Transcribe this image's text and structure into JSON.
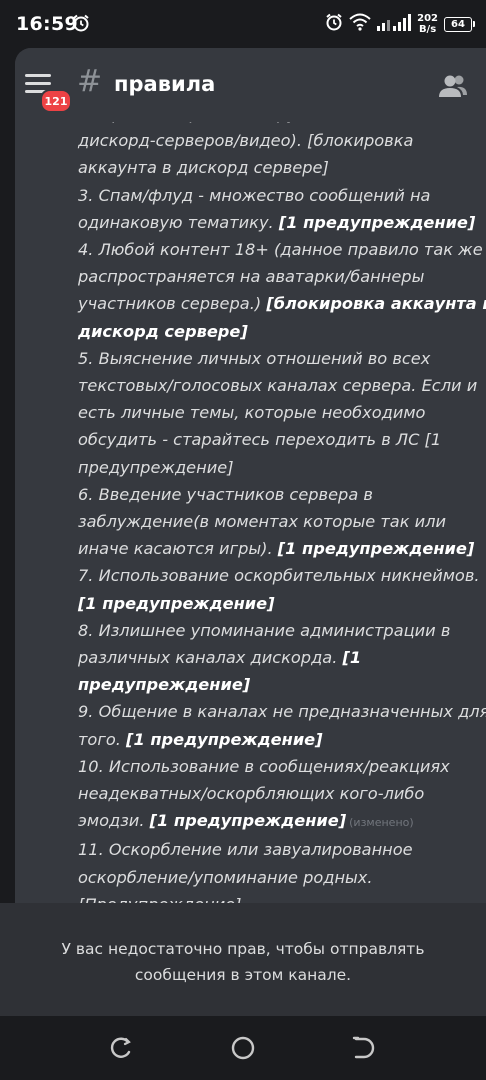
{
  "status_bar": {
    "time": "16:59",
    "net_speed_value": "202",
    "net_speed_unit": "B/s",
    "battery": "64"
  },
  "header": {
    "mention_count": "121",
    "hash_symbol": "#",
    "channel_name": "правила"
  },
  "message": {
    "lines": [
      {
        "t": "(сторонних проектов, групп, сайтов,",
        "b": ""
      },
      {
        "t": "дискорд-серверов/видео). [блокировка",
        "b": ""
      },
      {
        "t": "аккаунта в дискорд сервере]",
        "b": ""
      },
      {
        "t": "3. Спам/флуд - множество сообщений на",
        "b": ""
      },
      {
        "t": "одинаковую тематику. ",
        "b": "[1 предупреждение]"
      },
      {
        "t": "4. Любой контент 18+ (данное правило так же",
        "b": ""
      },
      {
        "t": "распространяется на аватарки/баннеры",
        "b": ""
      },
      {
        "t": "участников сервера.) ",
        "b": "[блокировка аккаунта в"
      },
      {
        "t": "",
        "b": "дискорд сервере]"
      },
      {
        "t": "5. Выяснение личных отношений во всех",
        "b": ""
      },
      {
        "t": "текстовых/голосовых каналах сервера. Если и",
        "b": ""
      },
      {
        "t": "есть личные темы, которые необходимо",
        "b": ""
      },
      {
        "t": "обсудить - старайтесь переходить в ЛС [1",
        "b": ""
      },
      {
        "t": "предупреждение]",
        "b": ""
      },
      {
        "t": "6. Введение участников сервера в",
        "b": ""
      },
      {
        "t": "заблуждение(в моментах которые так или",
        "b": ""
      },
      {
        "t": "иначе касаются игры). ",
        "b": "[1 предупреждение]"
      },
      {
        "t": "7. Использование оскорбительных никнеймов.",
        "b": ""
      },
      {
        "t": "",
        "b": "[1 предупреждение]"
      },
      {
        "t": "8. Излишнее упоминание администрации в",
        "b": ""
      },
      {
        "t": "различных каналах дискорда. ",
        "b": "[1"
      },
      {
        "t": "",
        "b": "предупреждение]"
      },
      {
        "t": "9. Общение в каналах не предназначенных для",
        "b": ""
      },
      {
        "t": "того. ",
        "b": "[1 предупреждение]"
      },
      {
        "t": "10. Использование в сообщениях/реакциях",
        "b": ""
      },
      {
        "t": "неадекватных/оскорбляющих кого-либо",
        "b": ""
      },
      {
        "t": "эмодзи. ",
        "b": "[1 предупреждение]"
      },
      {
        "t": "11. Оскорбление или завуалированное",
        "b": ""
      },
      {
        "t": "оскорбление/упоминание родных.",
        "b": ""
      },
      {
        "t": "[Предупреждение]",
        "b": ""
      }
    ],
    "edited_label": "(изменено)"
  },
  "notice": {
    "line1": "У вас недостаточно прав, чтобы отправлять",
    "line2": "сообщения в этом канале."
  },
  "icons": {
    "menu": "hamburger-menu-icon",
    "members": "members-icon",
    "alarm": "alarm-clock-icon",
    "wifi": "wifi-icon",
    "signal": "signal-icon",
    "recent": "recent-apps-icon",
    "home": "home-icon",
    "back": "back-icon"
  },
  "colors": {
    "background": "#36393f",
    "notice_bg": "#2f3136",
    "badge": "#ed4245",
    "text": "#dcddde"
  }
}
